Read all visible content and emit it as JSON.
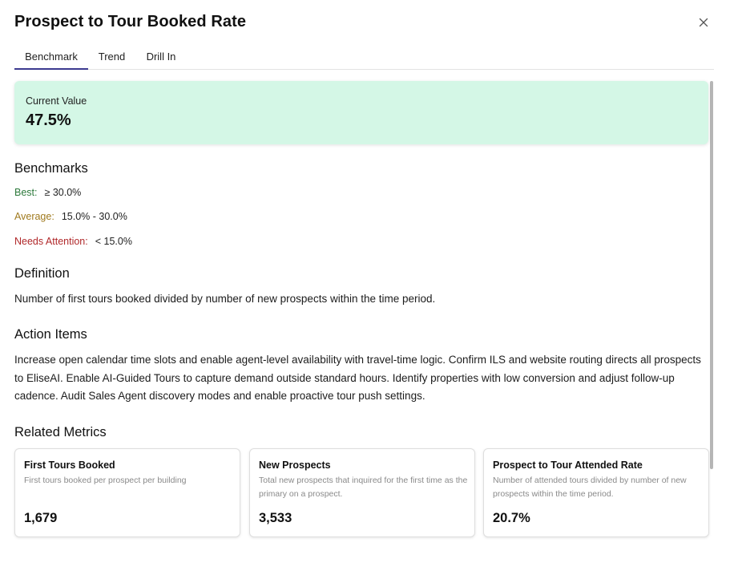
{
  "header": {
    "title": "Prospect to Tour Booked Rate"
  },
  "tabs": [
    {
      "label": "Benchmark",
      "active": true
    },
    {
      "label": "Trend",
      "active": false
    },
    {
      "label": "Drill In",
      "active": false
    }
  ],
  "current": {
    "label": "Current Value",
    "value": "47.5%"
  },
  "benchmarks": {
    "heading": "Benchmarks",
    "best": {
      "label": "Best:",
      "value": "≥ 30.0%"
    },
    "average": {
      "label": "Average:",
      "value": "15.0% - 30.0%"
    },
    "attention": {
      "label": "Needs Attention:",
      "value": "< 15.0%"
    }
  },
  "definition": {
    "heading": "Definition",
    "text": "Number of first tours booked divided by number of new prospects within the time period."
  },
  "actions": {
    "heading": "Action Items",
    "text": "Increase open calendar time slots and enable agent-level availability with travel-time logic. Confirm ILS and website routing directs all prospects to EliseAI. Enable AI-Guided Tours to capture demand outside standard hours. Identify properties with low conversion and adjust follow-up cadence. Audit Sales Agent discovery modes and enable proactive tour push settings."
  },
  "related": {
    "heading": "Related Metrics",
    "cards": [
      {
        "title": "First Tours Booked",
        "desc": "First tours booked per prospect per building",
        "value": "1,679"
      },
      {
        "title": "New Prospects",
        "desc": "Total new prospects that inquired for the first time as the primary on a prospect.",
        "value": "3,533"
      },
      {
        "title": "Prospect to Tour Attended Rate",
        "desc": "Number of attended tours divided by number of new prospects within the time period.",
        "value": "20.7%"
      }
    ]
  },
  "colors": {
    "current_bg": "#d4f7e6",
    "tab_active": "#3c3a8f",
    "best": "#2d7a3c",
    "average": "#a07a1e",
    "attention": "#b0282a"
  },
  "icons": {
    "close": "close-icon"
  }
}
